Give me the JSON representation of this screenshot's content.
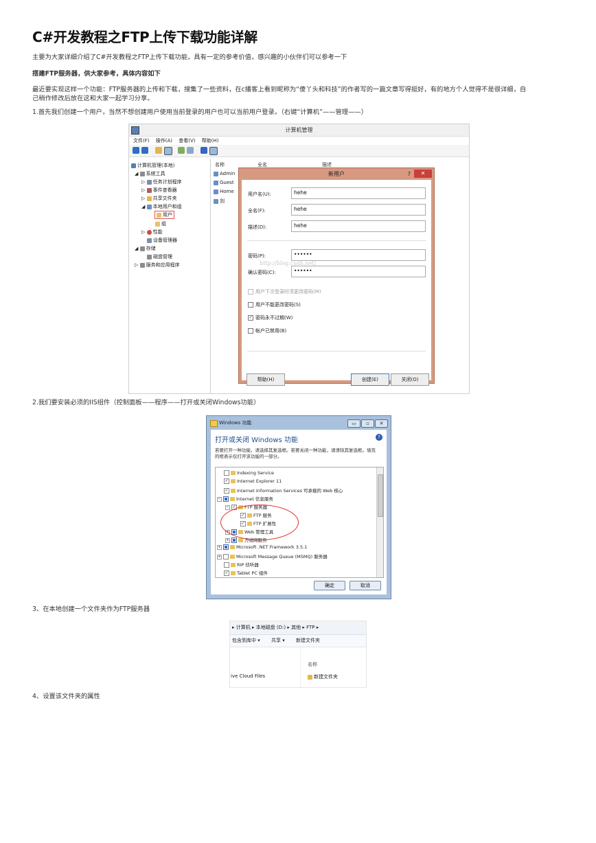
{
  "title": "C#开发教程之FTP上传下载功能详解",
  "intro": "主要为大家详细介绍了C#开发教程之FTP上传下载功能，具有一定的参考价值，感兴趣的小伙伴们可以参考一下",
  "section_heading": "搭建FTP服务器，供大家参考，具体内容如下",
  "para1": "最近要实现这样一个功能：FTP服务器的上传和下载，搜集了一些资料，在c播客上看到昵称为“傻丫头和科技”的作者写的一篇文章写得挺好，有的地方个人觉得不是很详细，自",
  "para1b": "己稍作修改后放在这和大家一起学习分享。",
  "step1": "1.首先我们创建一个用户，当然不想创建用户使用当前登录的用户也可以当前用户登录。（右键“计算机”——管理——）",
  "step2": "2.我们要安装必须的IIS组件（控制面板——程序——打开或关闭Windows功能）",
  "step3": "3、在本地创建一个文件夹作为FTP服务器",
  "step4": "4、设置该文件夹的属性",
  "fig1": {
    "window_title": "计算机管理",
    "menu": [
      "文件(F)",
      "操作(A)",
      "查看(V)",
      "帮助(H)"
    ],
    "tree": [
      "计算机管理(本地)",
      "系统工具",
      "任务计划程序",
      "事件查看器",
      "共享文件夹",
      "本地用户和组",
      "用户",
      "组",
      "性能",
      "设备管理器",
      "存储",
      "磁盘管理",
      "服务和应用程序"
    ],
    "columns": [
      "名称",
      "全名",
      "描述"
    ],
    "rows": [
      "Admin",
      "Guest",
      "Home",
      "剑"
    ],
    "dialog": {
      "title": "新用户",
      "help": "?",
      "close": "✕",
      "username_label": "用户名(U):",
      "username": "hehe",
      "fullname_label": "全名(F):",
      "fullname": "hehe",
      "desc_label": "描述(D):",
      "desc": "hehe",
      "pwd_label": "密码(P):",
      "pwd": "••••••",
      "confirm_label": "确认密码(C):",
      "confirm": "••••••",
      "chk1": "用户下次登录时须更改密码(M)",
      "chk2": "用户不能更改密码(S)",
      "chk3": "密码永不过期(W)",
      "chk4": "帐户已禁用(B)",
      "help_btn": "帮助(H)",
      "create_btn": "创建(E)",
      "close_btn": "关闭(O)",
      "watermark": "http://blog.csdn.net/"
    }
  },
  "fig2": {
    "window_title": "Windows 功能",
    "heading": "打开或关闭 Windows 功能",
    "help": "?",
    "desc": "若要打开一种功能，请选择其复选框。若要关闭一种功能，请清除其复选框。填充的框表示仅打开该功能的一部分。",
    "items": [
      "Indexing Service",
      "Internet Explorer 11",
      "Internet Information Services 可承载的 Web 核心",
      "Internet 信息服务",
      "FTP 服务器",
      "FTP 服务",
      "FTP 扩展性",
      "Web 管理工具",
      "万维网服务",
      "Microsoft .NET Framework 3.5.1",
      "Microsoft Message Queue (MSMQ) 服务器",
      "RIP 侦听器",
      "Tablet PC 组件"
    ],
    "ok": "确定",
    "cancel": "取消"
  },
  "fig3": {
    "address": "▸ 计算机 ▸ 本地磁盘 (D:) ▸ 其他 ▸ FTP ▸",
    "cmd": [
      "包含到库中 ▾",
      "共享 ▾",
      "新建文件夹"
    ],
    "side_item": "ive Cloud Files",
    "col_name": "名称",
    "folder": "新建文件夹"
  }
}
